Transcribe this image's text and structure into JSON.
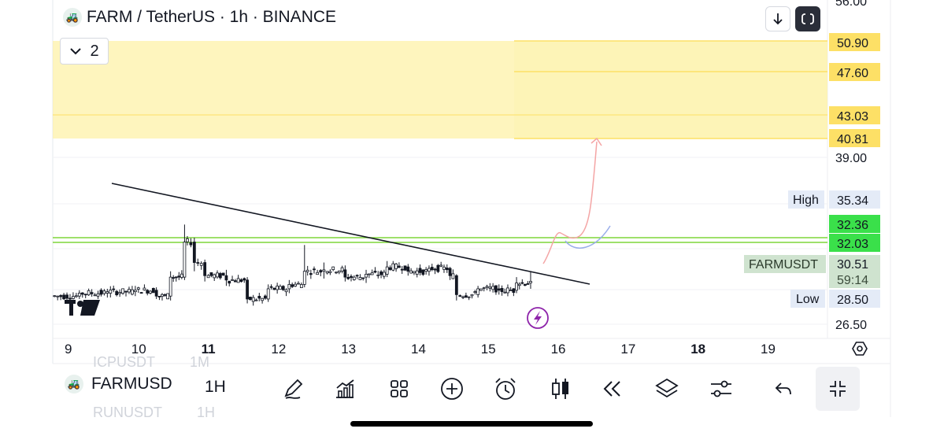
{
  "header": {
    "symbol_title": "FARM / TetherUS · 1h · BINANCE",
    "indicators_count": "2",
    "logo_icon": "farm-tractor-icon"
  },
  "chart_data": {
    "type": "candlestick",
    "symbol": "FARMUSDT",
    "interval": "1h",
    "x_ticks": [
      "9",
      "10",
      "11",
      "12",
      "13",
      "14",
      "15",
      "16",
      "17",
      "18",
      "19"
    ],
    "bold_x_ticks": [
      "11",
      "18"
    ],
    "y_ticks": [
      "56.00",
      "39.00",
      "26.50"
    ],
    "ylim": [
      25.5,
      56.0
    ],
    "price_axis_labels": {
      "resistance_top": "50.90",
      "resistance_2": "47.60",
      "resistance_3": "43.03",
      "resistance_4": "40.81",
      "high_label": "High",
      "high_value": "35.34",
      "support_top": "32.36",
      "support_bottom": "32.03",
      "symbol_label": "FARMUSDT",
      "last_price": "30.51",
      "countdown": "59:14",
      "low_label": "Low",
      "low_value": "28.50"
    },
    "zones": [
      {
        "name": "resistance",
        "from": 40.81,
        "to": 50.9,
        "color": "#fdf1a8"
      }
    ],
    "support_lines": [
      32.36,
      32.03
    ],
    "trendline": {
      "from": {
        "day": 9.62,
        "price": 34.95
      },
      "to": {
        "day": 16.45,
        "price": 29.55
      }
    },
    "scenarios": [
      {
        "kind": "bullish",
        "color": "#f4a5a5",
        "target": 40.81
      },
      {
        "kind": "retest",
        "color": "#9aaeea"
      }
    ],
    "candles_approx": [
      {
        "day": 8.8,
        "open": 29.3,
        "high": 29.8,
        "low": 29.0,
        "close": 29.5
      },
      {
        "day": 9.2,
        "open": 29.5,
        "high": 29.9,
        "low": 29.3,
        "close": 29.7
      },
      {
        "day": 9.6,
        "open": 29.7,
        "high": 30.0,
        "low": 29.4,
        "close": 29.8
      },
      {
        "day": 10.0,
        "open": 29.8,
        "high": 30.2,
        "low": 29.5,
        "close": 29.9
      },
      {
        "day": 10.3,
        "open": 29.9,
        "high": 30.1,
        "low": 29.3,
        "close": 29.5
      },
      {
        "day": 10.5,
        "open": 29.5,
        "high": 31.2,
        "low": 29.2,
        "close": 30.8
      },
      {
        "day": 10.7,
        "open": 30.8,
        "high": 34.4,
        "low": 30.6,
        "close": 33.2
      },
      {
        "day": 10.85,
        "open": 33.2,
        "high": 33.5,
        "low": 31.2,
        "close": 31.8
      },
      {
        "day": 11.0,
        "open": 31.8,
        "high": 32.0,
        "low": 30.5,
        "close": 30.9
      },
      {
        "day": 11.3,
        "open": 30.9,
        "high": 31.3,
        "low": 30.2,
        "close": 30.6
      },
      {
        "day": 11.6,
        "open": 30.6,
        "high": 30.8,
        "low": 29.0,
        "close": 29.3
      },
      {
        "day": 11.9,
        "open": 29.3,
        "high": 30.3,
        "low": 29.1,
        "close": 30.0
      },
      {
        "day": 12.2,
        "open": 30.0,
        "high": 30.6,
        "low": 29.7,
        "close": 30.3
      },
      {
        "day": 12.42,
        "open": 30.3,
        "high": 33.0,
        "low": 30.1,
        "close": 31.2
      },
      {
        "day": 12.7,
        "open": 31.2,
        "high": 31.8,
        "low": 30.7,
        "close": 31.3
      },
      {
        "day": 13.0,
        "open": 31.3,
        "high": 31.6,
        "low": 30.5,
        "close": 30.8
      },
      {
        "day": 13.3,
        "open": 30.8,
        "high": 31.3,
        "low": 30.4,
        "close": 31.0
      },
      {
        "day": 13.6,
        "open": 31.0,
        "high": 31.9,
        "low": 30.8,
        "close": 31.5
      },
      {
        "day": 13.9,
        "open": 31.5,
        "high": 31.7,
        "low": 30.9,
        "close": 31.2
      },
      {
        "day": 14.2,
        "open": 31.2,
        "high": 31.6,
        "low": 30.9,
        "close": 31.4
      },
      {
        "day": 14.5,
        "open": 31.4,
        "high": 31.5,
        "low": 30.6,
        "close": 30.9
      },
      {
        "day": 14.6,
        "open": 30.9,
        "high": 31.0,
        "low": 29.2,
        "close": 29.6
      },
      {
        "day": 14.9,
        "open": 29.6,
        "high": 30.2,
        "low": 29.4,
        "close": 30.0
      },
      {
        "day": 15.2,
        "open": 30.0,
        "high": 30.3,
        "low": 29.6,
        "close": 29.9
      },
      {
        "day": 15.45,
        "open": 29.9,
        "high": 30.8,
        "low": 29.7,
        "close": 30.4
      },
      {
        "day": 15.65,
        "open": 30.4,
        "high": 31.2,
        "low": 30.0,
        "close": 30.51
      }
    ]
  },
  "toolbar": {
    "symbol": "FARMUSD",
    "interval": "1H",
    "ghost_top_symbol": "ICPUSDT",
    "ghost_top_interval": "1M",
    "ghost_bottom_symbol": "RUNUSDT",
    "ghost_bottom_interval": "1H",
    "icons": [
      "pen-icon",
      "indicators-icon",
      "grid-icon",
      "add-circle-icon",
      "alarm-icon",
      "candles-icon",
      "replay-icon",
      "layers-icon",
      "settings-sliders-icon",
      "undo-icon",
      "collapse-icon"
    ]
  },
  "colors": {
    "zone_fill": "#fdf1a8",
    "zone_line": "#fde066",
    "support_line": "#7fd63a",
    "support_label_bg": "#3ae04a",
    "bullish_arrow": "#f4a5a5",
    "retest_curve": "#9aaeea",
    "candle": "#131722",
    "symbol_label_bg": "#cfe3cf",
    "high_low_bg": "#e4ebf7",
    "bolt": "#8e24aa"
  }
}
